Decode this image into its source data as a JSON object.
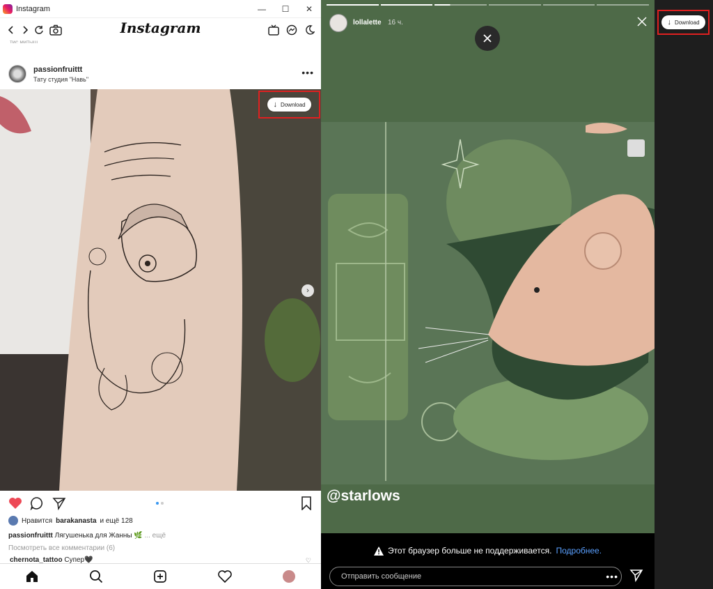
{
  "window": {
    "title": "Instagram",
    "minimize": "—",
    "maximize": "☐",
    "close": "✕"
  },
  "nav": {
    "brand": "Instagram",
    "clipped_text": "тис митыщ"
  },
  "post": {
    "username": "passionfruittt",
    "location": "Тату студия \"Навь\"",
    "more": "•••",
    "download_label": "Download"
  },
  "likes": {
    "prefix": "Нравится",
    "user": "barakanasta",
    "suffix": "и ещё 128"
  },
  "caption": {
    "user": "passionfruittt",
    "text": "Лягушенька для Жанны 🌿",
    "more": "... ещё"
  },
  "comments": {
    "view_all": "Посмотреть все комментарии (6)",
    "first_user": "chernota_tattoo",
    "first_text": "Супер🖤"
  },
  "story": {
    "username": "lollalette",
    "time": "16 ч.",
    "mention": "@starlows",
    "download_label": "Download",
    "progress": [
      1,
      1,
      0.3,
      0,
      0,
      0
    ]
  },
  "notice": {
    "text": "Этот браузер больше не поддерживается.",
    "link": "Подробнее."
  },
  "reply": {
    "placeholder": "Отправить сообщение",
    "more": "•••"
  },
  "colors": {
    "accent_link": "#5aa0ff",
    "highlight_outline": "#e02020",
    "story_bg": "#4e6a48",
    "like_red": "#ed4956"
  }
}
